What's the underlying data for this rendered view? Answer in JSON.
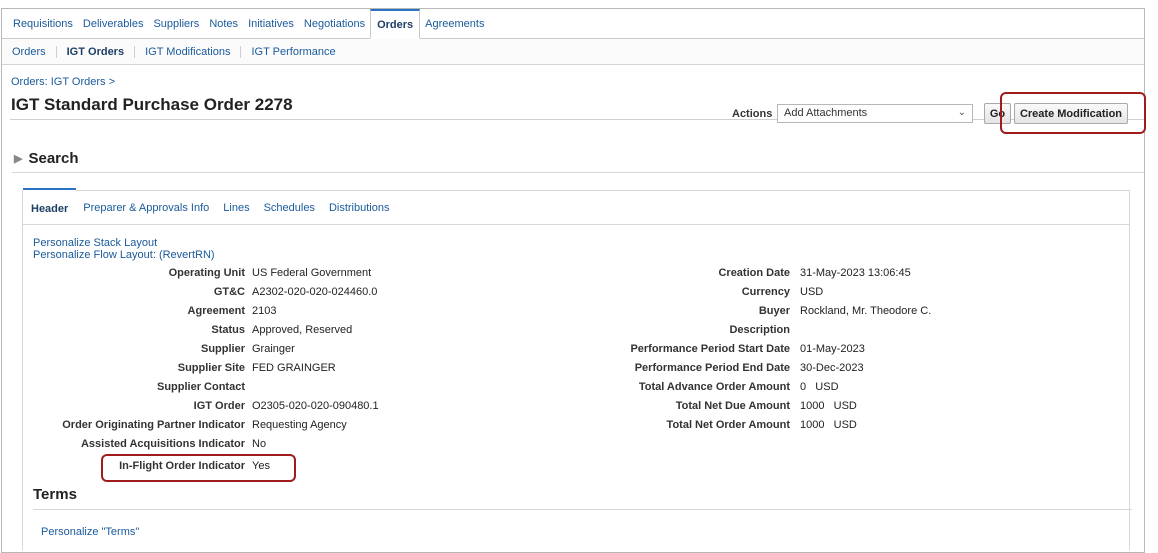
{
  "top_tabs": [
    "Requisitions",
    "Deliverables",
    "Suppliers",
    "Notes",
    "Initiatives",
    "Negotiations",
    "Orders",
    "Agreements"
  ],
  "sub_tabs": [
    "Orders",
    "IGT Orders",
    "IGT Modifications",
    "IGT Performance"
  ],
  "breadcrumb": "Orders: IGT Orders  >",
  "page_title": "IGT Standard Purchase Order 2278",
  "actions": {
    "label": "Actions",
    "selected": "Add Attachments",
    "go_label": "Go",
    "create_label": "Create Modification"
  },
  "search_label": "Search",
  "section_tabs": [
    "Header",
    "Preparer & Approvals Info",
    "Lines",
    "Schedules",
    "Distributions"
  ],
  "personalize_stack": "Personalize Stack Layout",
  "personalize_flow": "Personalize Flow Layout: (RevertRN)",
  "left_fields": [
    {
      "label": "Operating Unit",
      "value": "US Federal Government"
    },
    {
      "label": "GT&C",
      "value": "A2302-020-020-024460.0"
    },
    {
      "label": "Agreement",
      "value": "2103"
    },
    {
      "label": "Status",
      "value": "Approved, Reserved"
    },
    {
      "label": "Supplier",
      "value": "Grainger"
    },
    {
      "label": "Supplier Site",
      "value": "FED GRAINGER"
    },
    {
      "label": "Supplier Contact",
      "value": ""
    },
    {
      "label": "IGT Order",
      "value": "O2305-020-020-090480.1"
    },
    {
      "label": "Order Originating Partner Indicator",
      "value": "Requesting Agency"
    },
    {
      "label": "Assisted Acquisitions Indicator",
      "value": "No"
    },
    {
      "label": "In-Flight Order Indicator",
      "value": "Yes"
    }
  ],
  "right_fields": [
    {
      "label": "Creation Date",
      "value": "31-May-2023 13:06:45"
    },
    {
      "label": "Currency",
      "value": "USD"
    },
    {
      "label": "Buyer",
      "value": "Rockland, Mr. Theodore C."
    },
    {
      "label": "Description",
      "value": ""
    },
    {
      "label": "Performance Period Start Date",
      "value": "01-May-2023"
    },
    {
      "label": "Performance Period End Date",
      "value": "30-Dec-2023"
    },
    {
      "label": "Total Advance Order Amount",
      "value": "0   USD"
    },
    {
      "label": "Total Net Due Amount",
      "value": "1000   USD"
    },
    {
      "label": "Total Net Order Amount",
      "value": "1000   USD"
    }
  ],
  "terms_label": "Terms",
  "personalize_terms": "Personalize \"Terms\"",
  "colors": {
    "link": "#1a5a9a",
    "highlight": "#a01c1c",
    "active_tab_border": "#2a72c4"
  }
}
